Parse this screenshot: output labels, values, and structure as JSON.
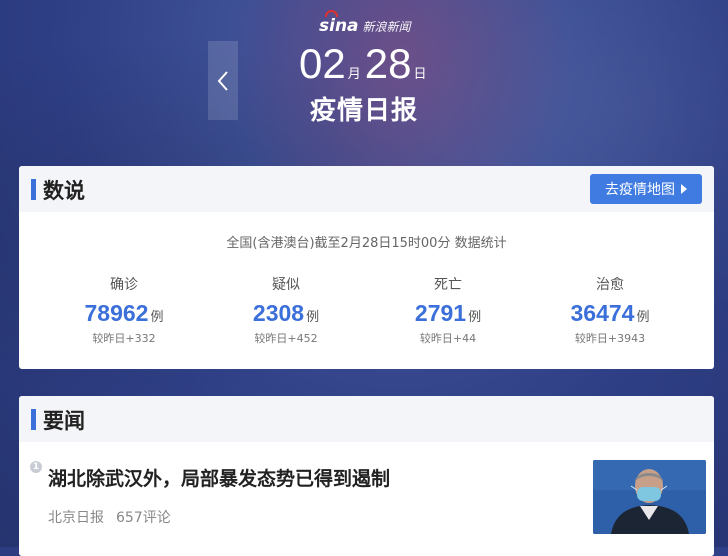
{
  "brand": {
    "logo": "sina",
    "name": "新浪新闻"
  },
  "header": {
    "month": "02",
    "month_unit": "月",
    "day": "28",
    "day_unit": "日",
    "title": "疫情日报",
    "back_icon": "chevron-left-icon"
  },
  "stats_card": {
    "heading": "数说",
    "map_button": "去疫情地图",
    "subline": "全国(含港澳台)截至2月28日15时00分 数据统计",
    "items": [
      {
        "label": "确诊",
        "value": "78962",
        "unit": "例",
        "delta": "较昨日+332"
      },
      {
        "label": "疑似",
        "value": "2308",
        "unit": "例",
        "delta": "较昨日+452"
      },
      {
        "label": "死亡",
        "value": "2791",
        "unit": "例",
        "delta": "较昨日+44"
      },
      {
        "label": "治愈",
        "value": "36474",
        "unit": "例",
        "delta": "较昨日+3943"
      }
    ]
  },
  "news_card": {
    "heading": "要闻",
    "items": [
      {
        "rank": "1",
        "headline": "湖北除武汉外，局部暴发态势已得到遏制",
        "source": "北京日报",
        "comments": "657评论"
      }
    ]
  },
  "colors": {
    "accent": "#3b6fd9",
    "button": "#3f7be0",
    "background": "#2f3f86"
  }
}
